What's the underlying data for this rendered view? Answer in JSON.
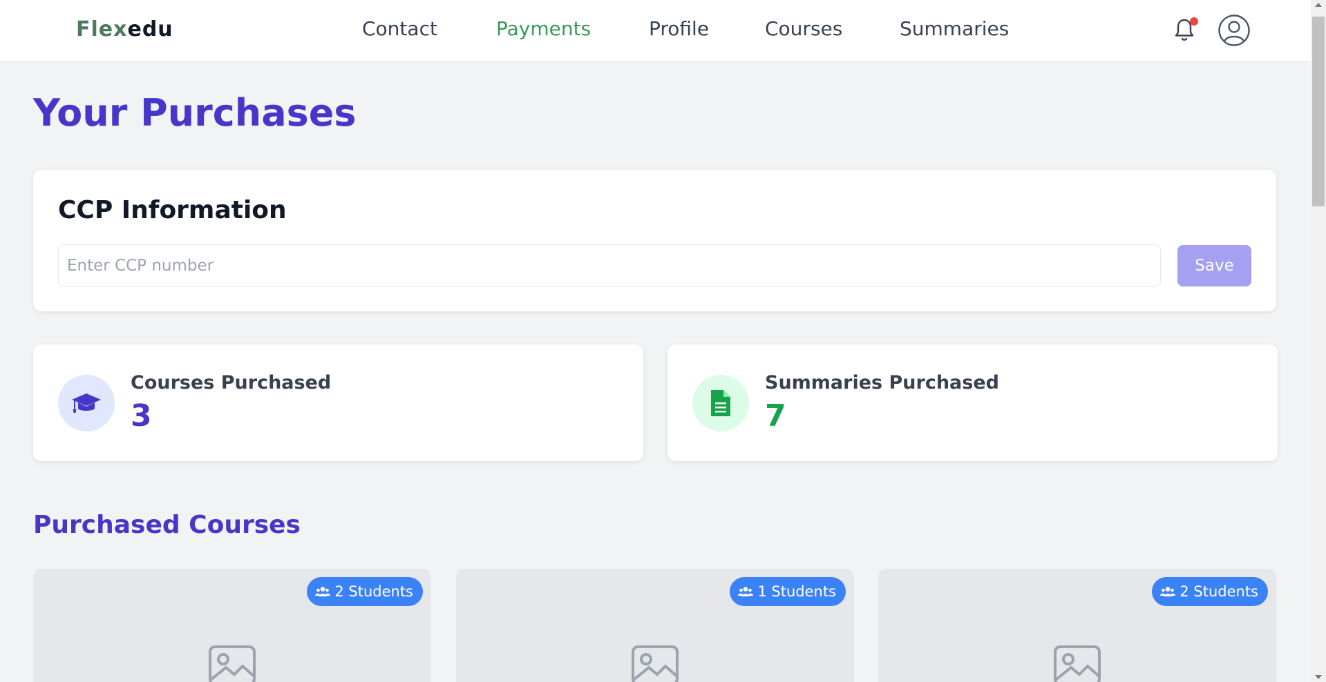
{
  "header": {
    "logo_part1": "Flex",
    "logo_part2": "edu",
    "nav": [
      {
        "label": "Contact",
        "active": false
      },
      {
        "label": "Payments",
        "active": true
      },
      {
        "label": "Profile",
        "active": false
      },
      {
        "label": "Courses",
        "active": false
      },
      {
        "label": "Summaries",
        "active": false
      }
    ],
    "icons": [
      "bell-icon",
      "notification-dot",
      "user-avatar-icon"
    ]
  },
  "page": {
    "title": "Your Purchases"
  },
  "ccp": {
    "title": "CCP Information",
    "placeholder": "Enter CCP number",
    "value": "",
    "save_label": "Save"
  },
  "stats": {
    "courses": {
      "label": "Courses Purchased",
      "value": "3",
      "icon": "graduation-cap-icon",
      "color": "#4636c9",
      "icon_bg": "#e0e7ff"
    },
    "summaries": {
      "label": "Summaries Purchased",
      "value": "7",
      "icon": "document-icon",
      "color": "#16a34a",
      "icon_bg": "#dcfce7"
    }
  },
  "purchased_courses": {
    "title": "Purchased Courses",
    "items": [
      {
        "students": "2 Students"
      },
      {
        "students": "1 Students"
      },
      {
        "students": "2 Students"
      }
    ]
  },
  "colors": {
    "accent": "#4636c9",
    "nav_active": "#3a9a55",
    "badge": "#3b82f6",
    "save_button": "#a5a0f2",
    "notification": "#ef4444"
  }
}
